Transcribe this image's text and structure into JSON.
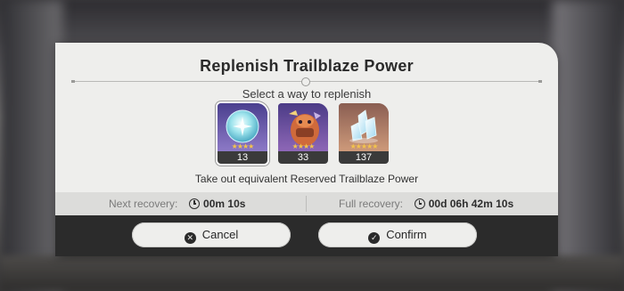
{
  "dialog": {
    "title": "Replenish Trailblaze Power",
    "subtitle": "Select a way to replenish",
    "caption": "Take out equivalent Reserved Trailblaze Power"
  },
  "items": [
    {
      "icon": "crystal-orb-icon",
      "stars": "★★★★",
      "count": "13",
      "selected": true
    },
    {
      "icon": "fuel-character-icon",
      "stars": "★★★★",
      "count": "33",
      "selected": false
    },
    {
      "icon": "stellar-jade-crystal-icon",
      "stars": "★★★★★",
      "count": "137",
      "selected": false
    }
  ],
  "recovery": {
    "next_label": "Next recovery:",
    "next_value": "00m 10s",
    "full_label": "Full recovery:",
    "full_value": "00d 06h 42m 10s"
  },
  "buttons": {
    "cancel": "Cancel",
    "confirm": "Confirm",
    "cancel_icon": "close-icon",
    "confirm_icon": "check-icon"
  },
  "colors": {
    "panel": "#eeeeec",
    "button_bar": "#2b2b2b",
    "recovery_bar": "#dcdcda",
    "star": "#f3c34c"
  }
}
